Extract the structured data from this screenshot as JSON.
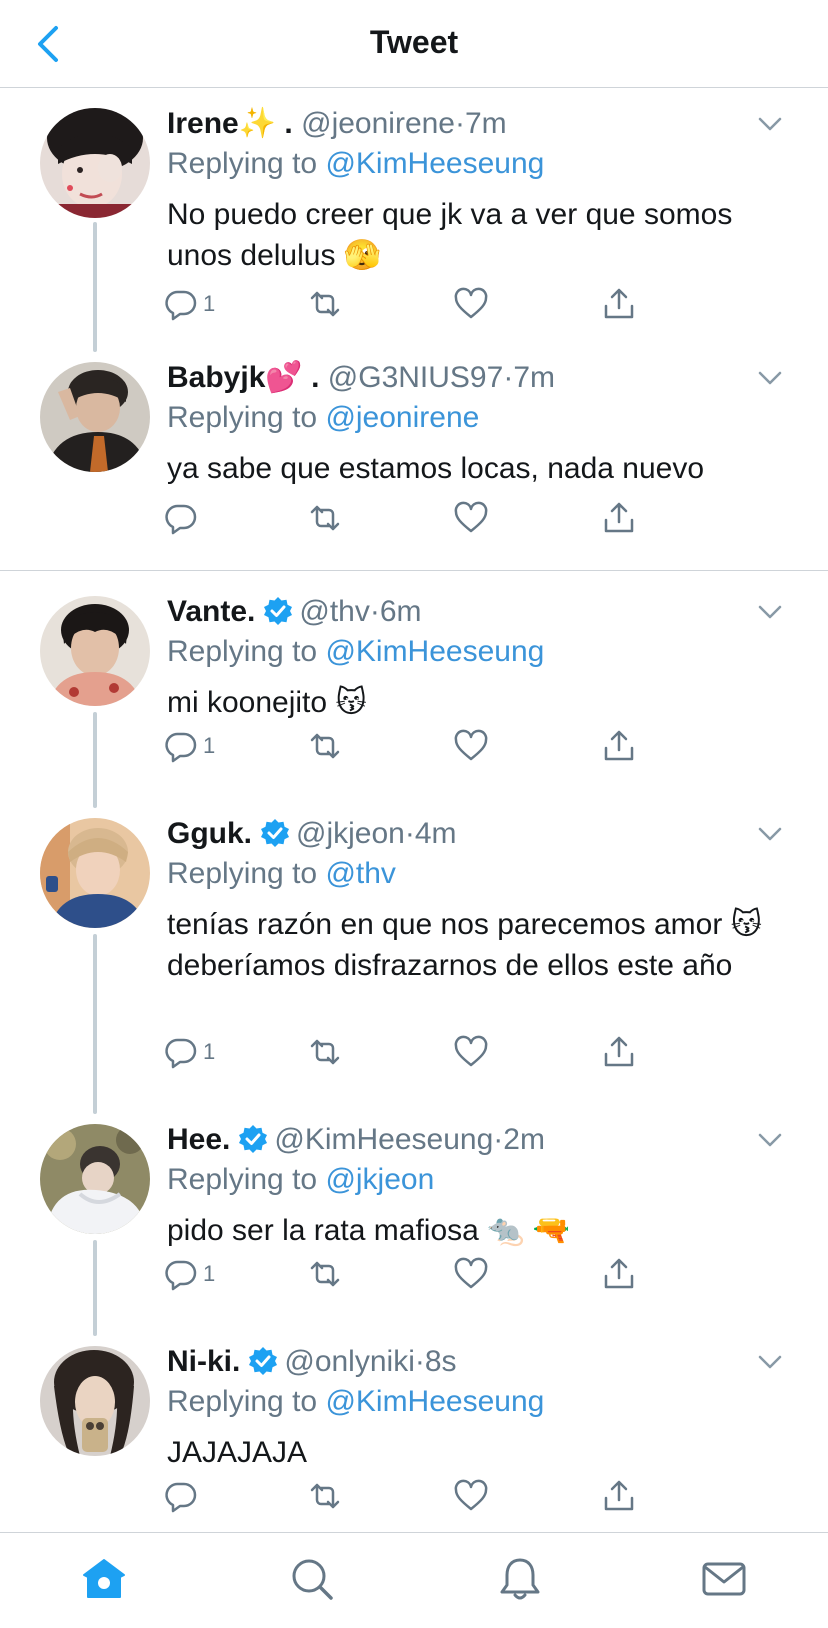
{
  "header": {
    "title": "Tweet"
  },
  "tweets": [
    {
      "name": "Irene",
      "emoji": "✨",
      "dot": ".",
      "verified": false,
      "handle": "@jeonirene",
      "sep": "·",
      "time": "7m",
      "replying_prefix": "Replying to",
      "replying_handle": "@KimHeeseung",
      "text": "No puedo creer que jk va a ver que somos unos delulus 🫣",
      "reply_count": "1"
    },
    {
      "name": "Babyjk",
      "emoji": "💕",
      "dot": ".",
      "verified": false,
      "handle": "@G3NIUS97",
      "sep": "·",
      "time": "7m",
      "replying_prefix": "Replying to",
      "replying_handle": "@jeonirene",
      "text": "ya sabe que estamos locas, nada nuevo",
      "reply_count": ""
    },
    {
      "name": "Vante.",
      "verified": true,
      "handle": "@thv",
      "sep": "·",
      "time": "6m",
      "replying_prefix": "Replying to",
      "replying_handle": "@KimHeeseung",
      "text": "mi koonejito 😽",
      "reply_count": "1"
    },
    {
      "name": "Gguk.",
      "verified": true,
      "handle": "@jkjeon",
      "sep": "·",
      "time": "4m",
      "replying_prefix": "Replying to",
      "replying_handle": "@thv",
      "text": "tenías razón en que nos parecemos amor 😽 deberíamos disfrazarnos de ellos este año",
      "reply_count": "1"
    },
    {
      "name": "Hee.",
      "verified": true,
      "handle": "@KimHeeseung",
      "sep": "·",
      "time": "2m",
      "replying_prefix": "Replying to",
      "replying_handle": "@jkjeon",
      "text": "pido ser la rata mafiosa 🐀 🔫",
      "reply_count": "1"
    },
    {
      "name": "Ni-ki.",
      "verified": true,
      "handle": "@onlyniki",
      "sep": "·",
      "time": "8s",
      "replying_prefix": "Replying to",
      "replying_handle": "@KimHeeseung",
      "text": "JAJAJAJA",
      "reply_count": ""
    }
  ],
  "icons": {
    "back": "chevron-left-icon",
    "caret": "chevron-down-icon",
    "reply": "reply-icon",
    "retweet": "retweet-icon",
    "like": "heart-icon",
    "share": "share-icon",
    "verified": "verified-badge-icon",
    "tabs": [
      "home-icon",
      "search-icon",
      "notifications-icon",
      "messages-icon"
    ]
  },
  "colors": {
    "accent": "#1da1f2",
    "link": "#3b94d9",
    "muted": "#657786",
    "thread_line": "#c4cfd6"
  }
}
